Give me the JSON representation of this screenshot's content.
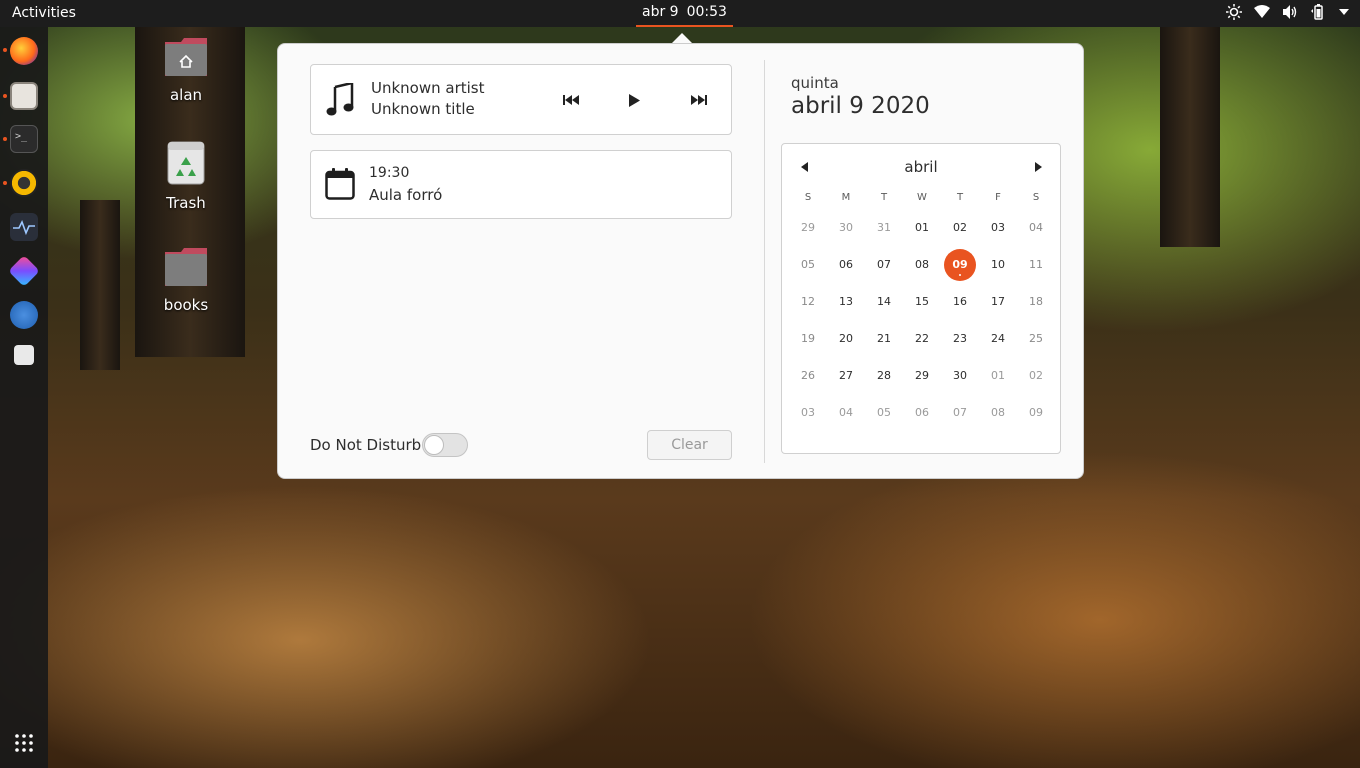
{
  "topbar": {
    "activities": "Activities",
    "date": "abr 9",
    "time": "00:53",
    "tray_icons": [
      "brightness-icon",
      "wifi-icon",
      "volume-icon",
      "battery-icon",
      "menu-arrow-icon"
    ]
  },
  "dock": {
    "items": [
      "firefox-icon",
      "files-icon",
      "terminal-icon",
      "rhythmbox-icon",
      "system-monitor-icon",
      "app-icon",
      "text-editor-icon",
      "settings-icon"
    ],
    "apps_grid_icon": "show-applications-icon",
    "accent": "#e95420"
  },
  "desktop": {
    "icons": [
      {
        "label": "alan"
      },
      {
        "label": "Trash"
      },
      {
        "label": "books"
      }
    ]
  },
  "media": {
    "artist": "Unknown artist",
    "title": "Unknown title"
  },
  "event": {
    "time": "19:30",
    "name": "Aula forró"
  },
  "dnd": {
    "label": "Do Not Disturb",
    "enabled": false
  },
  "clear_label": "Clear",
  "date_header": {
    "weekday": "quinta",
    "full": "abril 9 2020"
  },
  "calendar": {
    "month": "abril",
    "dow": [
      "S",
      "M",
      "T",
      "W",
      "T",
      "F",
      "S"
    ],
    "weeks": [
      [
        "29",
        "30",
        "31",
        "01",
        "02",
        "03",
        "04"
      ],
      [
        "05",
        "06",
        "07",
        "08",
        "09",
        "10",
        "11"
      ],
      [
        "12",
        "13",
        "14",
        "15",
        "16",
        "17",
        "18"
      ],
      [
        "19",
        "20",
        "21",
        "22",
        "23",
        "24",
        "25"
      ],
      [
        "26",
        "27",
        "28",
        "29",
        "30",
        "01",
        "02"
      ],
      [
        "03",
        "04",
        "05",
        "06",
        "07",
        "08",
        "09"
      ]
    ],
    "today": "09",
    "accent": "#e95420"
  }
}
